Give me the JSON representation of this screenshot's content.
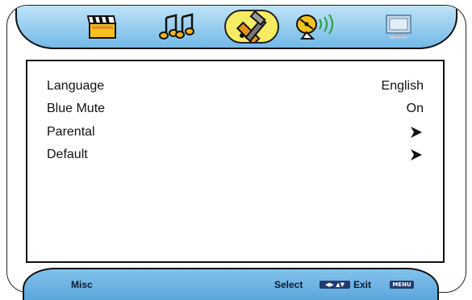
{
  "menu_tabs": [
    {
      "icon": "clapperboard-icon",
      "selected": false
    },
    {
      "icon": "music-notes-icon",
      "selected": false
    },
    {
      "icon": "tools-icon",
      "selected": true
    },
    {
      "icon": "satellite-dish-icon",
      "selected": false
    },
    {
      "icon": "monitor-icon",
      "selected": false
    }
  ],
  "settings": [
    {
      "label": "Language",
      "value": "English"
    },
    {
      "label": "Blue Mute",
      "value": "On"
    },
    {
      "label": "Parental",
      "value": "",
      "submenu": true
    },
    {
      "label": "Default",
      "value": "",
      "submenu": true
    }
  ],
  "footer": {
    "page_label": "Misc",
    "select_label": "Select",
    "exit_label": "Exit",
    "menu_key": "MENU"
  },
  "colors": {
    "topbar": "#9ad0f2",
    "selected_tab": "#f6ec64",
    "bottombar": "#6fb4e4"
  }
}
